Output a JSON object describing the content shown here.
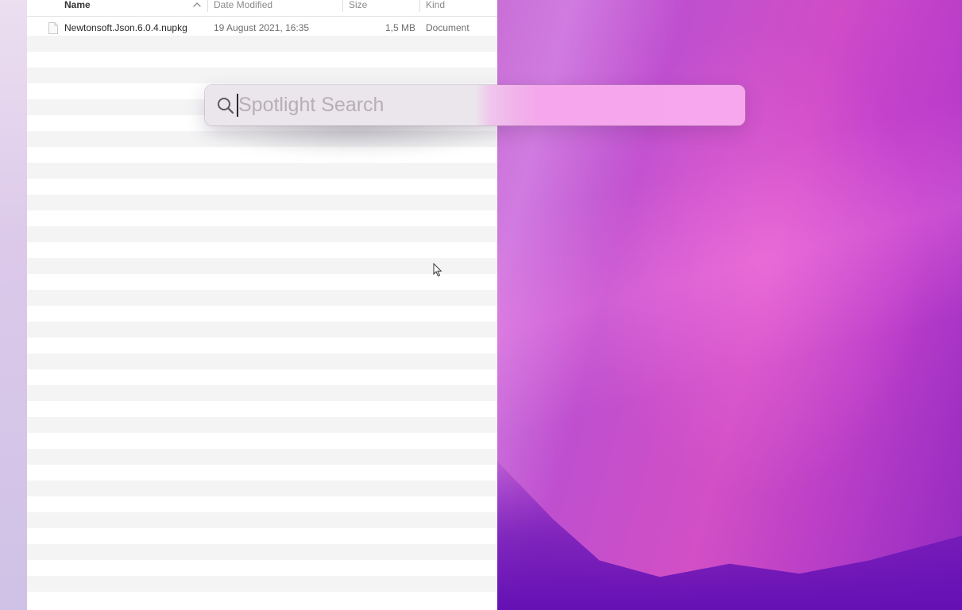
{
  "finder": {
    "columns": {
      "name": "Name",
      "date_modified": "Date Modified",
      "size": "Size",
      "kind": "Kind"
    },
    "sort": {
      "column": "name",
      "direction": "ascending"
    },
    "files": [
      {
        "icon": "document-icon",
        "name": "Newtonsoft.Json.6.0.4.nupkg",
        "date_modified": "19 August 2021, 16:35",
        "size": "1,5 MB",
        "kind": "Document"
      }
    ]
  },
  "spotlight": {
    "icon": "search-icon",
    "placeholder": "Spotlight Search",
    "value": ""
  },
  "colors": {
    "stripe": "#f4f4f5",
    "spotlight_bar": "#ebe6ec",
    "wallpaper_accent": "#c63fc0"
  }
}
